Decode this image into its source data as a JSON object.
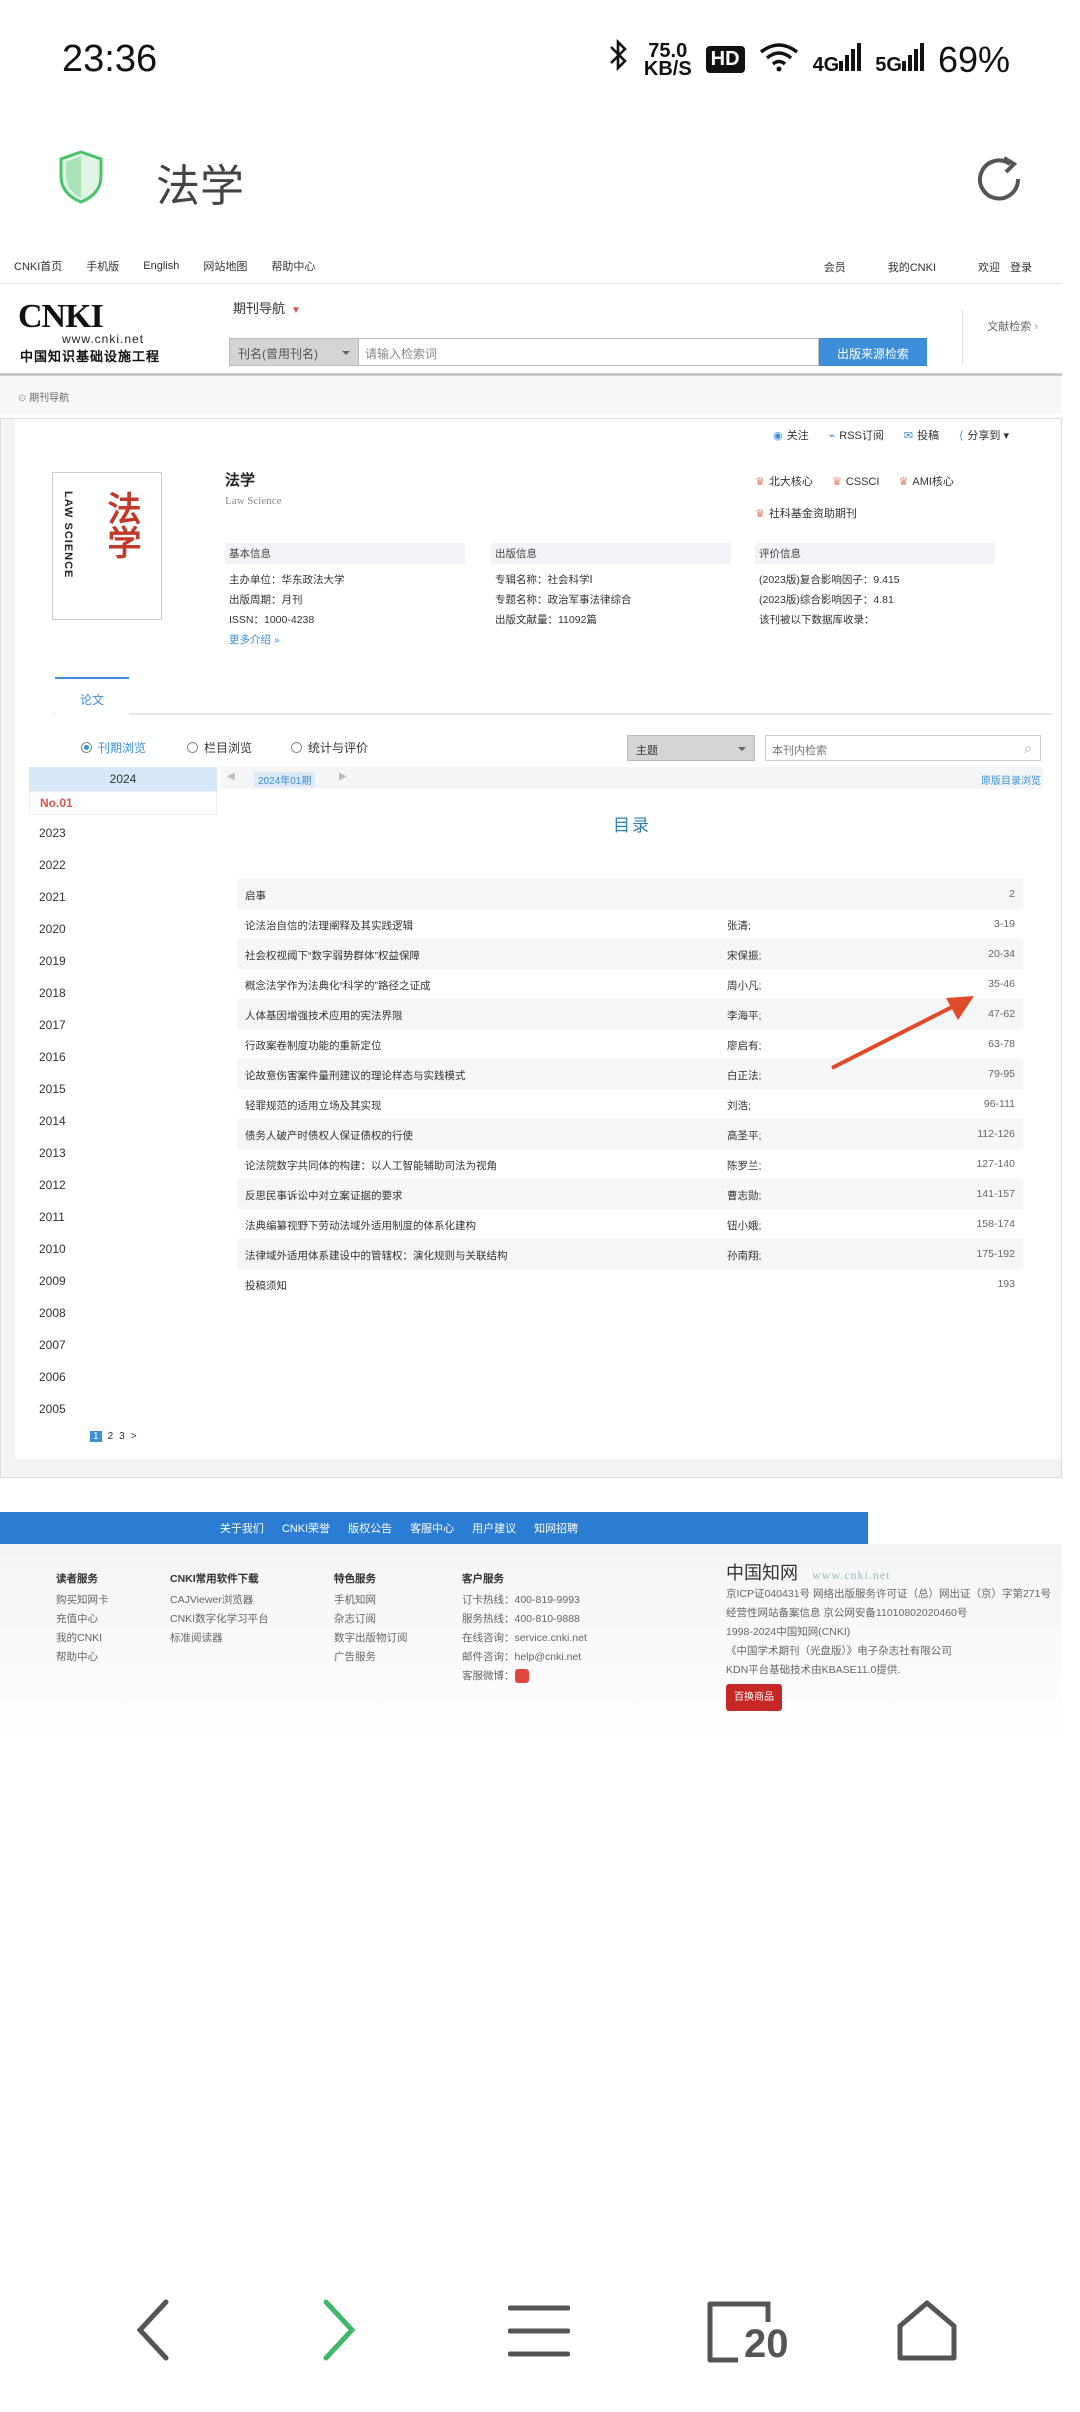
{
  "status": {
    "time": "23:36",
    "speed_value": "75.0",
    "speed_unit": "KB/S",
    "hd": "HD",
    "net1": "4G",
    "net2": "5G",
    "battery": "69%"
  },
  "browser": {
    "title": "法学",
    "tab_count": "20"
  },
  "topnav": {
    "left": [
      "CNKI首页",
      "手机版",
      "English",
      "网站地图",
      "帮助中心"
    ],
    "right": [
      "会员",
      "我的CNKI",
      "欢迎",
      "登录"
    ]
  },
  "header": {
    "logo_en": "CNKI",
    "logo_url": "www.cnki.net",
    "logo_cn": "中国知识基础设施工程",
    "journal_nav": "期刊导航",
    "search_select": "刊名(曾用刊名)",
    "search_placeholder": "请输入检索词",
    "search_button": "出版来源检索",
    "adv_search": "文献检索"
  },
  "breadcrumb": "期刊导航",
  "actions": [
    "关注",
    "RSS订阅",
    "投稿",
    "分享到"
  ],
  "journal": {
    "cover_vertical": "LAW SCIENCE",
    "cover_title": "法学",
    "title": "法学",
    "subtitle": "Law Science",
    "badges": [
      "北大核心",
      "CSSCI",
      "AMI核心",
      "社科基金资助期刊"
    ],
    "basic_header": "基本信息",
    "basic": [
      "主办单位：华东政法大学",
      "出版周期：月刊",
      "ISSN：1000-4238"
    ],
    "more": "更多介绍",
    "pub_header": "出版信息",
    "pub": [
      "专辑名称：社会科学Ⅰ",
      "专题名称：政治军事法律综合",
      "出版文献量：11092篇"
    ],
    "eval_header": "评价信息",
    "eval": [
      "(2023版)复合影响因子：9.415",
      "(2023版)综合影响因子：4.81",
      "该刊被以下数据库收录："
    ]
  },
  "tab": "论文",
  "browse_modes": [
    "刊期浏览",
    "栏目浏览",
    "统计与评价"
  ],
  "topic_select": "主题",
  "inner_search_placeholder": "本刊内检索",
  "year_panel": {
    "current_year": "2024",
    "issue": "No.01",
    "years": [
      "2023",
      "2022",
      "2021",
      "2020",
      "2019",
      "2018",
      "2017",
      "2016",
      "2015",
      "2014",
      "2013",
      "2012",
      "2011",
      "2010",
      "2009",
      "2008",
      "2007",
      "2006",
      "2005"
    ],
    "pages": [
      "1",
      "2",
      "3",
      ">"
    ]
  },
  "toc": {
    "issue_label": "2024年01期",
    "original_browse": "原版目录浏览",
    "title": "目录",
    "rows": [
      {
        "t": "启事",
        "a": "",
        "p": "2"
      },
      {
        "t": "论法治自信的法理阐释及其实践逻辑",
        "a": "张清;",
        "p": "3-19"
      },
      {
        "t": "社会权视阈下“数字弱势群体”权益保障",
        "a": "宋保振;",
        "p": "20-34"
      },
      {
        "t": "概念法学作为法典化“科学的”路径之证成",
        "a": "周小凡;",
        "p": "35-46"
      },
      {
        "t": "人体基因增强技术应用的宪法界限",
        "a": "李海平;",
        "p": "47-62"
      },
      {
        "t": "行政案卷制度功能的重新定位",
        "a": "廖启有;",
        "p": "63-78"
      },
      {
        "t": "论故意伤害案件量刑建议的理论样态与实践模式",
        "a": "白正法;",
        "p": "79-95"
      },
      {
        "t": "轻罪规范的适用立场及其实现",
        "a": "刘浩;",
        "p": "96-111"
      },
      {
        "t": "债务人破产时债权人保证债权的行使",
        "a": "高圣平;",
        "p": "112-126"
      },
      {
        "t": "论法院数字共同体的构建：以人工智能辅助司法为视角",
        "a": "陈罗兰;",
        "p": "127-140"
      },
      {
        "t": "反思民事诉讼中对立案证据的要求",
        "a": "曹志勋;",
        "p": "141-157"
      },
      {
        "t": "法典编纂视野下劳动法域外适用制度的体系化建构",
        "a": "钮小娥;",
        "p": "158-174"
      },
      {
        "t": "法律域外适用体系建设中的管辖权：演化规则与关联结构",
        "a": "孙南翔;",
        "p": "175-192"
      },
      {
        "t": "投稿须知",
        "a": "",
        "p": "193"
      }
    ]
  },
  "footbar": [
    "关于我们",
    "CNKI荣誉",
    "版权公告",
    "客服中心",
    "用户建议",
    "知网招聘"
  ],
  "footer": {
    "col1": {
      "h": "读者服务",
      "items": [
        "购买知网卡",
        "充值中心",
        "我的CNKI",
        "帮助中心"
      ]
    },
    "col2": {
      "h": "CNKI常用软件下载",
      "items": [
        "CAJViewer浏览器",
        "CNKI数字化学习平台",
        "标准阅读器"
      ]
    },
    "col3": {
      "h": "特色服务",
      "items": [
        "手机知网",
        "杂志订阅",
        "数字出版物订阅",
        "广告服务"
      ]
    },
    "col4": {
      "h": "客户服务",
      "items": [
        "订卡热线：400-819-9993",
        "服务热线：400-810-9888",
        "在线咨询：service.cnki.net",
        "邮件咨询：help@cnki.net",
        "客服微博："
      ]
    },
    "right_logo": "中国知网",
    "right_url": "www.cnki.net",
    "right_lines": [
      "京ICP证040431号 网络出版服务许可证（总）网出证（京）字第271号",
      "经营性网站备案信息 京公网安备11010802020460号",
      "1998-2024中国知网(CNKI)",
      "《中国学术期刊（光盘版）》电子杂志社有限公司",
      "KDN平台基础技术由KBASE11.0提供."
    ],
    "shop": "百换商品"
  },
  "colors": {
    "accent": "#3d8ed8",
    "issue_red": "#d9534f",
    "footbar": "#2b7cd3",
    "arrow": "#e04a2c"
  }
}
